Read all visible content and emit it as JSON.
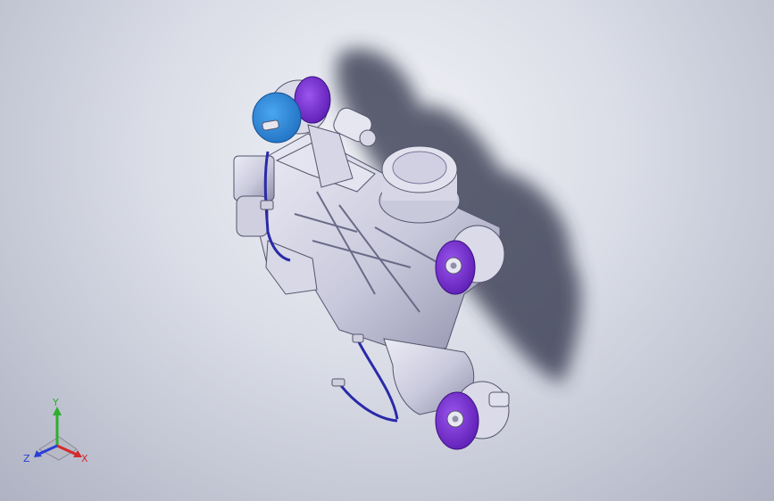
{
  "triad": {
    "x_label": "X",
    "y_label": "Y",
    "z_label": "Z",
    "x_color": "#d42a2a",
    "y_color": "#2fae2f",
    "z_color": "#2a3fd4"
  },
  "colors": {
    "housing": "#d3d3e3",
    "housing_dark": "#9a9ab6",
    "pulley": "#7b2fd6",
    "cap": "#2f8fe3",
    "hose": "#2a2aa8",
    "shadow": "#2b2f45"
  }
}
